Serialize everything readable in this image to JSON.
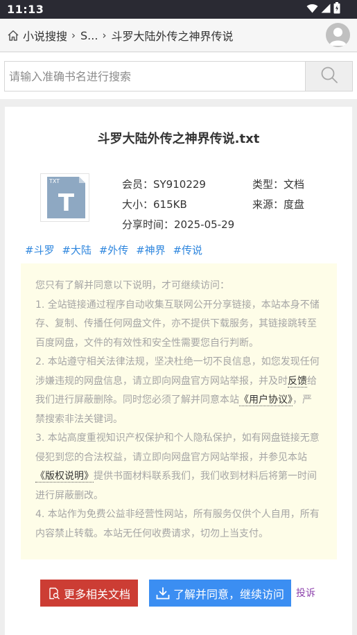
{
  "status_bar": {
    "time": "11:13"
  },
  "breadcrumb": {
    "items": [
      "小说搜搜",
      "S...",
      "斗罗大陆外传之神界传说"
    ]
  },
  "search": {
    "placeholder": "请输入准确书名进行搜索"
  },
  "doc": {
    "title": "斗罗大陆外传之神界传说.txt",
    "file_badge": "TXT",
    "file_letter": "T",
    "member": "会员：SY910229",
    "type": "类型：文档",
    "size": "大小：615KB",
    "source": "来源：度盘",
    "share_time": "分享时间：2025-05-29",
    "tags": [
      "#斗罗",
      "#大陆",
      "#外传",
      "#神界",
      "#传说"
    ]
  },
  "notice": {
    "intro": "您只有了解并同意以下说明，才可继续访问：",
    "p1": "1. 全站链接通过程序自动收集互联网公开分享链接，本站本身不储存、复制、传播任何网盘文件，亦不提供下载服务，其链接跳转至百度网盘，文件的有效性和安全性需要您自行判断。",
    "p2_a": "2. 本站遵守相关法律法规，坚决杜绝一切不良信息，如您发现任何涉嫌违规的网盘信息，请立即向网盘官方网站举报，并及时",
    "p2_link1": "反馈",
    "p2_b": "给我们进行屏蔽删除。同时您必须了解并同意本站",
    "p2_link2": "《用户协议》",
    "p2_c": "，严禁搜索非法关键词。",
    "p3_a": "3. 本站高度重视知识产权保护和个人隐私保护，如有网盘链接无意侵犯到您的合法权益，请立即向网盘官方网站举报，并参见本站",
    "p3_link": "《版权说明》",
    "p3_b": "提供书面材料联系我们，我们收到材料后将第一时间进行屏蔽删改。",
    "p4": "4. 本站作为免费公益非经营性网站，所有服务仅供个人自用，所有内容禁止转载。本站无任何收费请求，切勿上当支付。"
  },
  "actions": {
    "more_label": "更多相关文档",
    "agree_label": "了解并同意，继续访问",
    "report_label": "投诉"
  },
  "colors": {
    "status_bar": "#2a2a33",
    "tag": "#2e86de",
    "more_button": "#cc3d34",
    "agree_button": "#3b8ef2",
    "report": "#8e44ad",
    "notice_bg": "#fefde8"
  },
  "icons": [
    "wifi-icon",
    "signal-icon",
    "battery-icon",
    "home-icon",
    "avatar-icon",
    "search-icon",
    "txt-file-icon",
    "document-search-icon",
    "download-icon"
  ]
}
